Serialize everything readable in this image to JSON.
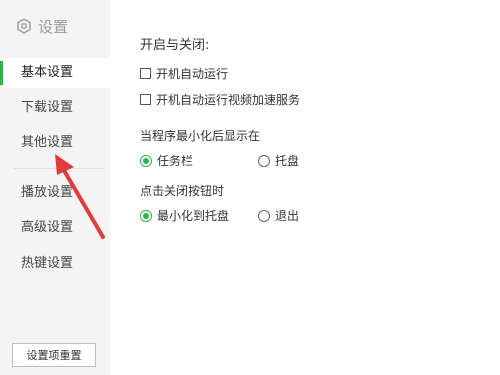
{
  "sidebar": {
    "title": "设置",
    "items": [
      {
        "label": "基本设置",
        "active": true
      },
      {
        "label": "下载设置",
        "active": false
      },
      {
        "label": "其他设置",
        "active": false
      },
      {
        "label": "播放设置",
        "active": false
      },
      {
        "label": "高级设置",
        "active": false
      },
      {
        "label": "热键设置",
        "active": false
      }
    ],
    "reset_label": "设置项重置"
  },
  "main": {
    "startup": {
      "title": "开启与关闭:",
      "options": [
        {
          "label": "开机自动运行",
          "checked": false
        },
        {
          "label": "开机自动运行视频加速服务",
          "checked": false
        }
      ]
    },
    "minimize": {
      "title": "当程序最小化后显示在",
      "options": [
        {
          "label": "任务栏",
          "selected": true
        },
        {
          "label": "托盘",
          "selected": false
        }
      ]
    },
    "close_button": {
      "title": "点击关闭按钮时",
      "options": [
        {
          "label": "最小化到托盘",
          "selected": true
        },
        {
          "label": "退出",
          "selected": false
        }
      ]
    }
  },
  "colors": {
    "accent": "#2fb34a",
    "sidebar_bg": "#f4f4f4",
    "annotation_arrow": "#e03c3c"
  }
}
